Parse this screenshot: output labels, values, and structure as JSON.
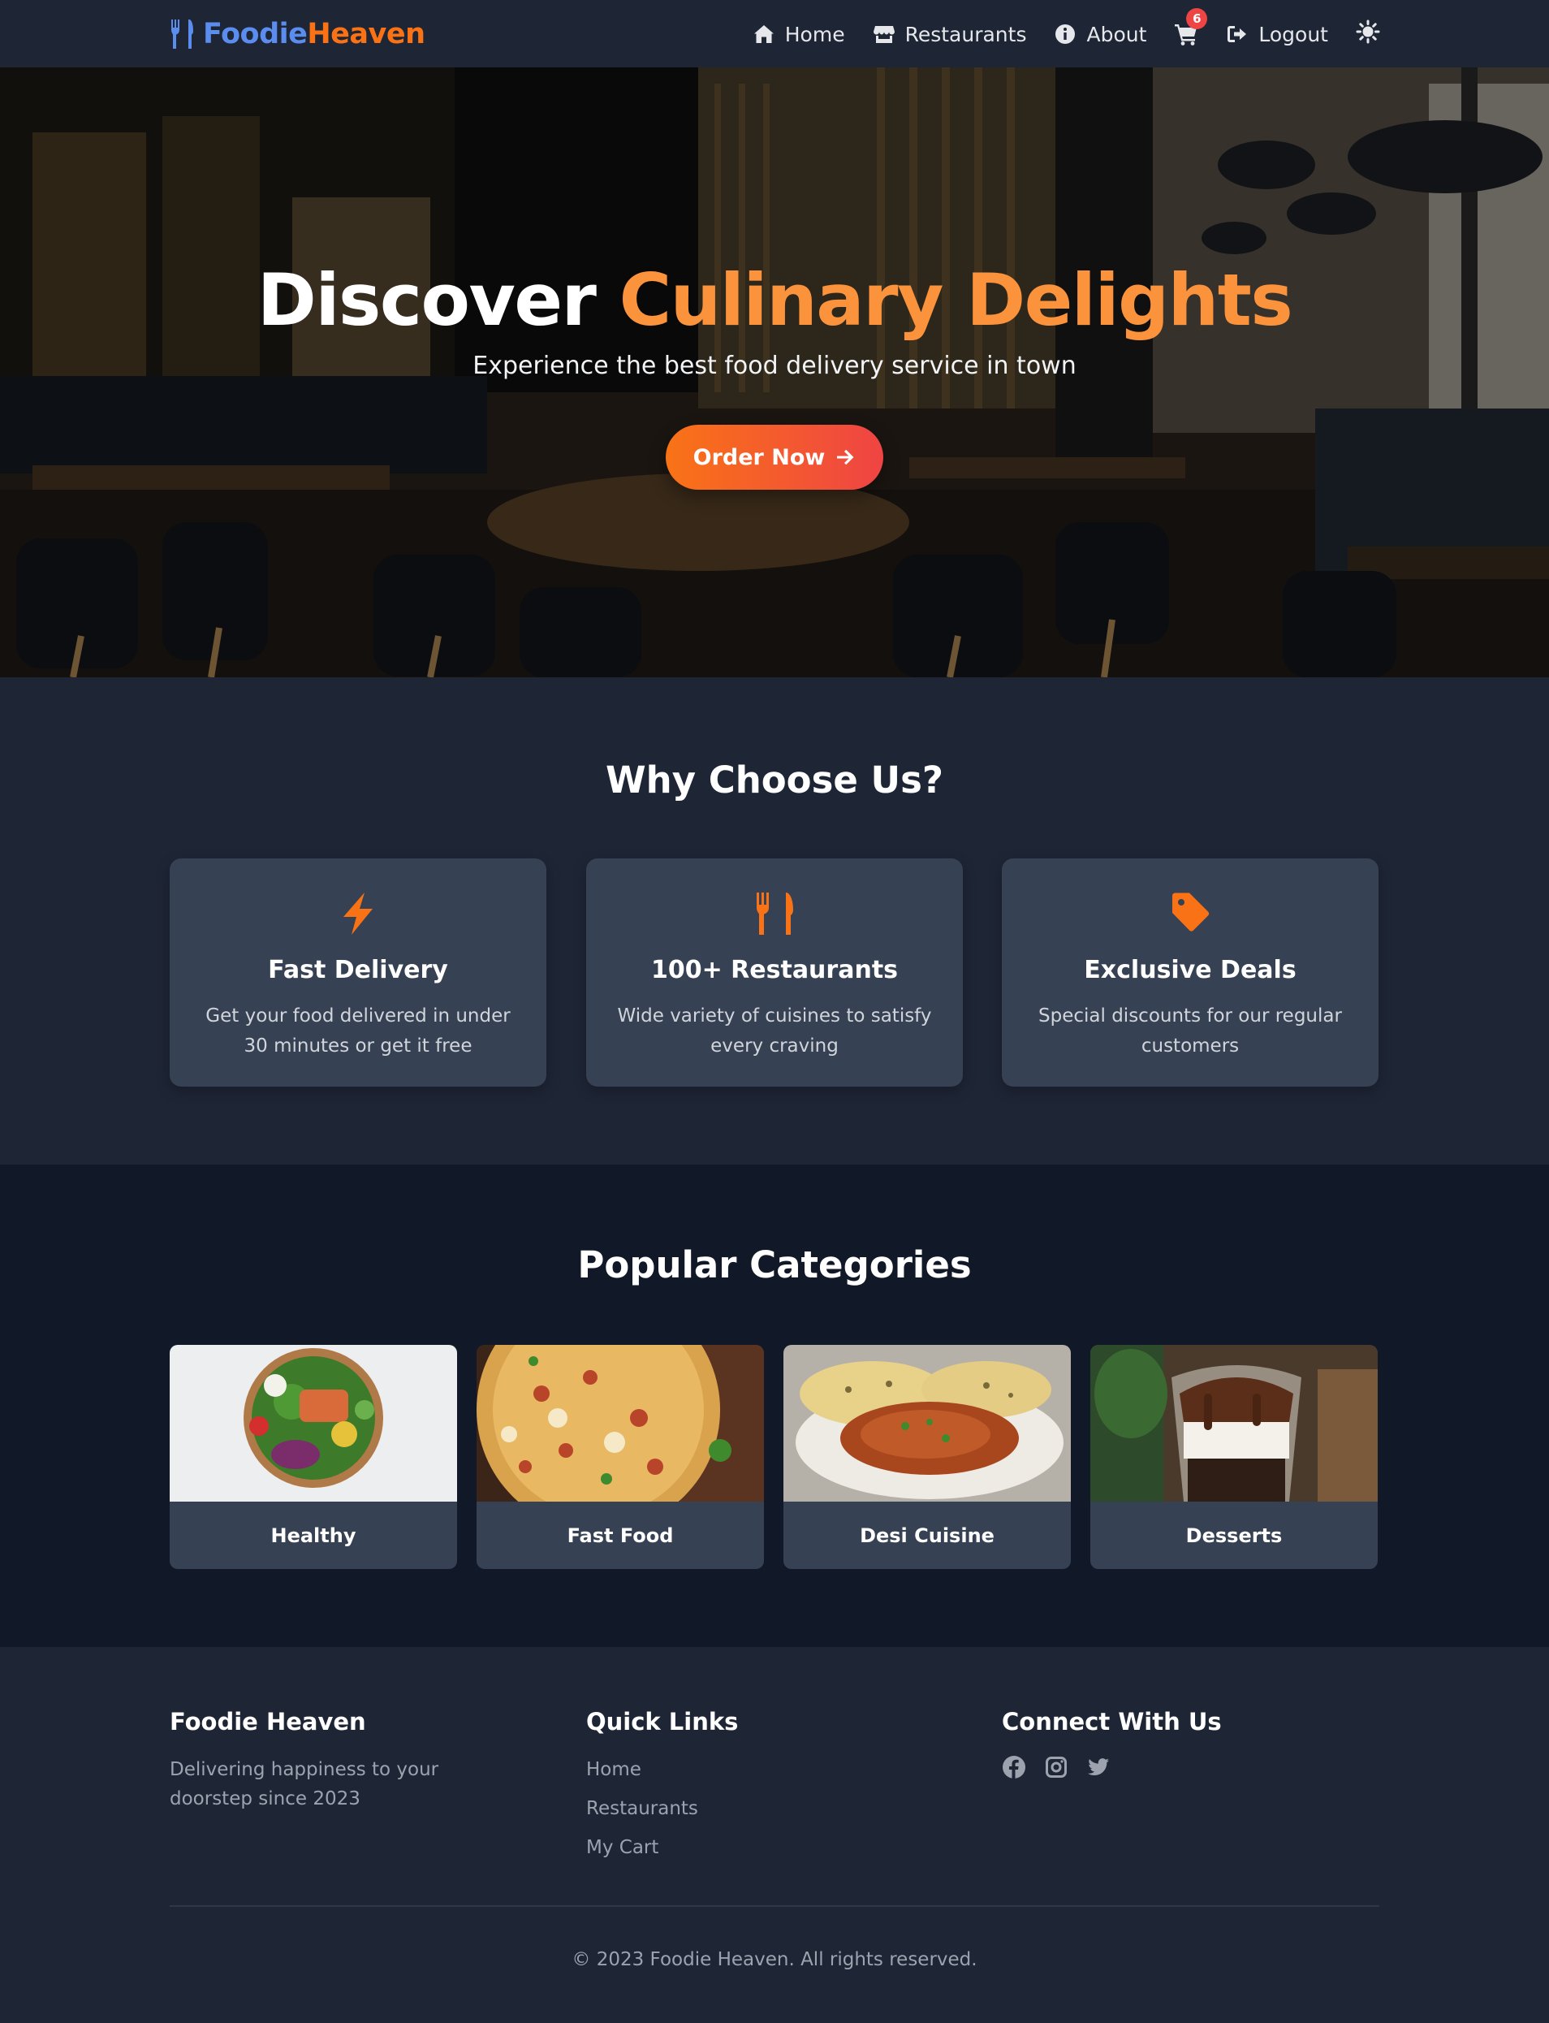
{
  "brand": {
    "part1": "Foodie",
    "part2": "Heaven"
  },
  "nav": {
    "items": [
      {
        "label": "Home",
        "icon": "home-icon"
      },
      {
        "label": "Restaurants",
        "icon": "store-icon"
      },
      {
        "label": "About",
        "icon": "info-icon"
      }
    ],
    "cart_count": "6",
    "logout_label": "Logout"
  },
  "hero": {
    "title_plain": "Discover ",
    "title_accent": "Culinary Delights",
    "subtitle": "Experience the best food delivery service in town",
    "cta_label": "Order Now"
  },
  "why": {
    "title": "Why Choose Us?",
    "features": [
      {
        "icon": "bolt-icon",
        "title": "Fast Delivery",
        "text": "Get your food delivered in under 30 minutes or get it free"
      },
      {
        "icon": "utensils-icon",
        "title": "100+ Restaurants",
        "text": "Wide variety of cuisines to satisfy every craving"
      },
      {
        "icon": "tag-icon",
        "title": "Exclusive Deals",
        "text": "Special discounts for our regular customers"
      }
    ]
  },
  "categories": {
    "title": "Popular Categories",
    "items": [
      {
        "name": "Healthy"
      },
      {
        "name": "Fast Food"
      },
      {
        "name": "Desi Cuisine"
      },
      {
        "name": "Desserts"
      }
    ]
  },
  "footer": {
    "brand_title": "Foodie Heaven",
    "brand_text": "Delivering happiness to your doorstep since 2023",
    "links_title": "Quick Links",
    "links": [
      "Home",
      "Restaurants",
      "My Cart"
    ],
    "social_title": "Connect With Us",
    "social_icons": [
      "facebook-icon",
      "instagram-icon",
      "twitter-icon"
    ],
    "copyright": "© 2023 Foodie Heaven. All rights reserved."
  },
  "colors": {
    "accent": "#f97316",
    "brand_blue": "#5b8def",
    "badge": "#ef4444",
    "bg": "#1e2535",
    "card": "#364153"
  }
}
